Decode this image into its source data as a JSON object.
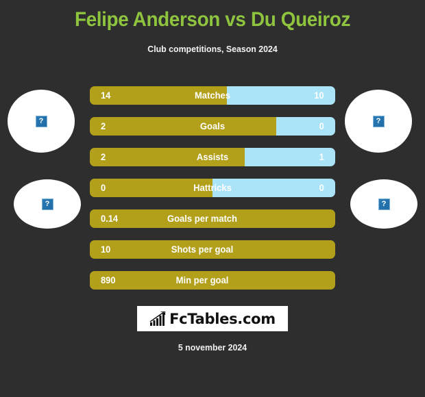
{
  "header": {
    "title": "Felipe Anderson vs Du Queiroz",
    "subtitle": "Club competitions, Season 2024",
    "title_color": "#8fc43f"
  },
  "players": {
    "left": {
      "photo_alt": "broken-image",
      "placeholder_glyph": "?"
    },
    "right": {
      "photo_alt": "broken-image",
      "placeholder_glyph": "?"
    }
  },
  "colors": {
    "background": "#2e2e2e",
    "bar_left": "#b3a01a",
    "bar_right": "#abe4f9",
    "text": "#ffffff"
  },
  "stats": [
    {
      "label": "Matches",
      "left": "14",
      "right": "10",
      "left_pct": 56,
      "dual": true
    },
    {
      "label": "Goals",
      "left": "2",
      "right": "0",
      "left_pct": 76,
      "dual": true
    },
    {
      "label": "Assists",
      "left": "2",
      "right": "1",
      "left_pct": 63,
      "dual": true
    },
    {
      "label": "Hattricks",
      "left": "0",
      "right": "0",
      "left_pct": 50,
      "dual": true
    },
    {
      "label": "Goals per match",
      "left": "0.14",
      "right": "",
      "left_pct": 100,
      "dual": false
    },
    {
      "label": "Shots per goal",
      "left": "10",
      "right": "",
      "left_pct": 100,
      "dual": false
    },
    {
      "label": "Min per goal",
      "left": "890",
      "right": "",
      "left_pct": 100,
      "dual": false
    }
  ],
  "logo": {
    "text": "FcTables.com",
    "icon": "bar-chart-trend-icon"
  },
  "footer": {
    "date": "5 november 2024"
  },
  "chart_data": {
    "type": "bar",
    "title": "Felipe Anderson vs Du Queiroz",
    "subtitle": "Club competitions, Season 2024",
    "categories": [
      "Matches",
      "Goals",
      "Assists",
      "Hattricks",
      "Goals per match",
      "Shots per goal",
      "Min per goal"
    ],
    "series": [
      {
        "name": "Felipe Anderson",
        "values": [
          14,
          2,
          2,
          0,
          0.14,
          10,
          890
        ],
        "color": "#b3a01a"
      },
      {
        "name": "Du Queiroz",
        "values": [
          10,
          0,
          1,
          0,
          null,
          null,
          null
        ],
        "color": "#abe4f9"
      }
    ],
    "legend": "none",
    "grid": false,
    "orientation": "horizontal-split-bars"
  }
}
